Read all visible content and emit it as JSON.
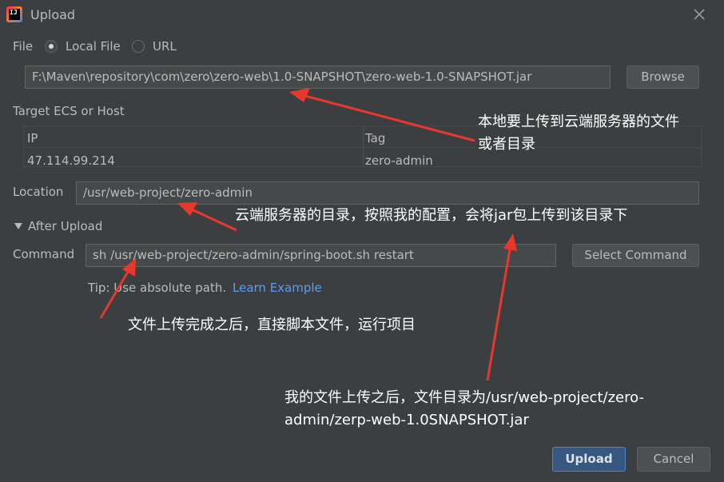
{
  "window": {
    "title": "Upload"
  },
  "file": {
    "label": "File",
    "options": [
      {
        "label": "Local File",
        "checked": true
      },
      {
        "label": "URL",
        "checked": false
      }
    ],
    "path": "F:\\Maven\\repository\\com\\zero\\zero-web\\1.0-SNAPSHOT\\zero-web-1.0-SNAPSHOT.jar",
    "browse_label": "Browse"
  },
  "target": {
    "label": "Target ECS or Host",
    "columns": [
      "IP",
      "Tag"
    ],
    "rows": [
      {
        "ip": "47.114.99.214",
        "tag": "zero-admin"
      }
    ]
  },
  "location": {
    "label": "Location",
    "value": "/usr/web-project/zero-admin"
  },
  "after_upload": {
    "label": "After Upload",
    "command_label": "Command",
    "command_value": "sh /usr/web-project/zero-admin/spring-boot.sh restart",
    "select_command_label": "Select Command",
    "tip_prefix": "Tip: Use absolute path.",
    "learn_link": "Learn Example"
  },
  "footer": {
    "upload_label": "Upload",
    "cancel_label": "Cancel"
  },
  "annotations": {
    "a1_line1": "本地要上传到云端服务器的文件",
    "a1_line2": "或者目录",
    "a2": "云端服务器的目录，按照我的配置，会将jar包上传到该目录下",
    "a3": "文件上传完成之后，直接脚本文件，运行项目",
    "a4_line1": "我的文件上传之后，文件目录为/usr/web-project/zero-",
    "a4_line2": "admin/zerp-web-1.0SNAPSHOT.jar"
  },
  "colors": {
    "background": "#3c3f41",
    "accent": "#365880",
    "link": "#589df6",
    "annotation_arrow": "#e8382e"
  },
  "icons": {
    "app": "intellij-icon",
    "close": "close-icon",
    "expand": "triangle-down-icon"
  }
}
